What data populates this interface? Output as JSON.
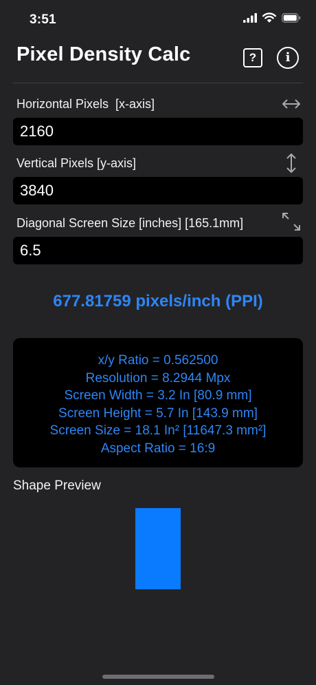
{
  "status_bar": {
    "time": "3:51",
    "icons": [
      "signal-icon",
      "wifi-icon",
      "battery-icon"
    ]
  },
  "header": {
    "title": "Pixel Density Calc",
    "help_glyph": "?",
    "info_glyph": "i"
  },
  "fields": {
    "horizontal": {
      "label": "Horizontal Pixels  [x-axis]",
      "value": "2160",
      "icon": "horizontal-arrow-icon"
    },
    "vertical": {
      "label": "Vertical Pixels [y-axis]",
      "value": "3840",
      "icon": "vertical-arrow-icon"
    },
    "diagonal": {
      "label": "Diagonal Screen Size [inches] [165.1mm]",
      "value": "6.5",
      "icon": "diagonal-arrows-icon"
    }
  },
  "result": {
    "ppi": "677.81759 pixels/inch (PPI)"
  },
  "stats": {
    "ratio": "x/y Ratio = 0.562500",
    "resolution": "Resolution = 8.2944 Mpx",
    "width": "Screen Width = 3.2 In [80.9 mm]",
    "height": "Screen Height = 5.7 In [143.9 mm]",
    "size": "Screen Size = 18.1 In² [11647.3 mm²]",
    "aspect": "Aspect Ratio = 16:9"
  },
  "preview": {
    "title": "Shape Preview",
    "aspect_ratio": 0.5625
  },
  "colors": {
    "accent": "#2e86f5",
    "preview_fill": "#0a7aff",
    "background": "#232325",
    "input_background": "#000000"
  }
}
